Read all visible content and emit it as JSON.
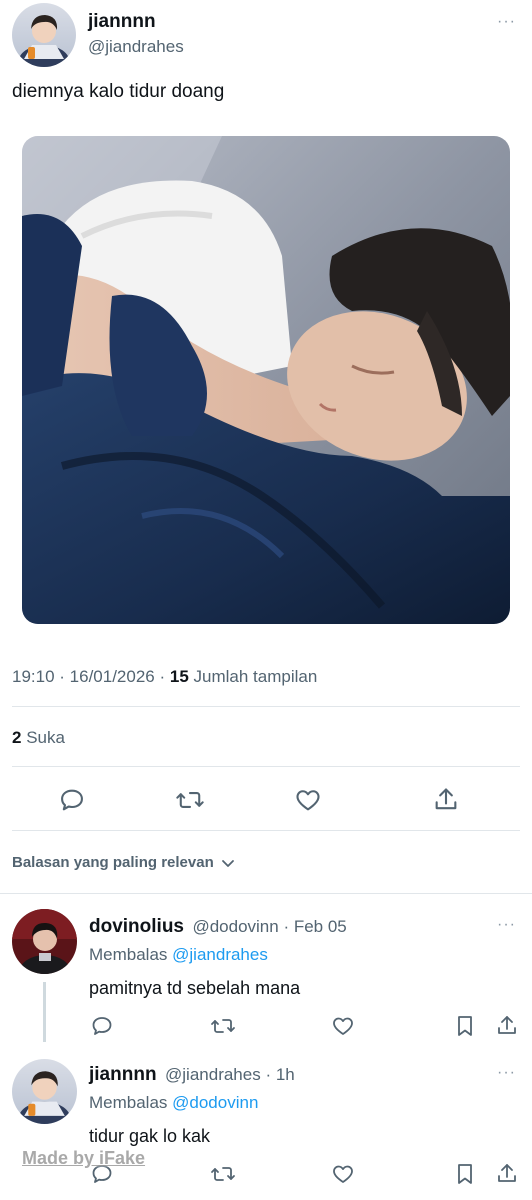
{
  "tweet": {
    "author_name": "jiannnn",
    "author_handle": "@jiandrahes",
    "more": "···",
    "text": "diemnya kalo tidur doang",
    "time": "19:10",
    "sep1": " · ",
    "date": "16/01/2026",
    "sep2": " · ",
    "views_count": "15",
    "views_label": " Jumlah tampilan",
    "likes_count": "2",
    "likes_label": " Suka"
  },
  "actions": {
    "icons": [
      "reply-icon",
      "retweet-icon",
      "like-icon",
      "share-icon"
    ]
  },
  "replies_sort": {
    "label": "Balasan yang paling relevan"
  },
  "replies": [
    {
      "name": "dovinolius",
      "handle": "@dodovinn",
      "sep": " · ",
      "date": "Feb 05",
      "more": "···",
      "replying_prefix": "Membalas ",
      "replying_to": "@jiandrahes",
      "text": "pamitnya td sebelah mana"
    },
    {
      "name": "jiannnn",
      "handle": "@jiandrahes",
      "sep": " · ",
      "date": "1h",
      "more": "···",
      "replying_prefix": "Membalas ",
      "replying_to": "@dodovinn",
      "text": "tidur gak lo kak"
    }
  ],
  "watermark": "Made by iFake",
  "colors": {
    "accent": "#1d9bf0",
    "text": "#0f1419",
    "secondary": "#536471"
  }
}
